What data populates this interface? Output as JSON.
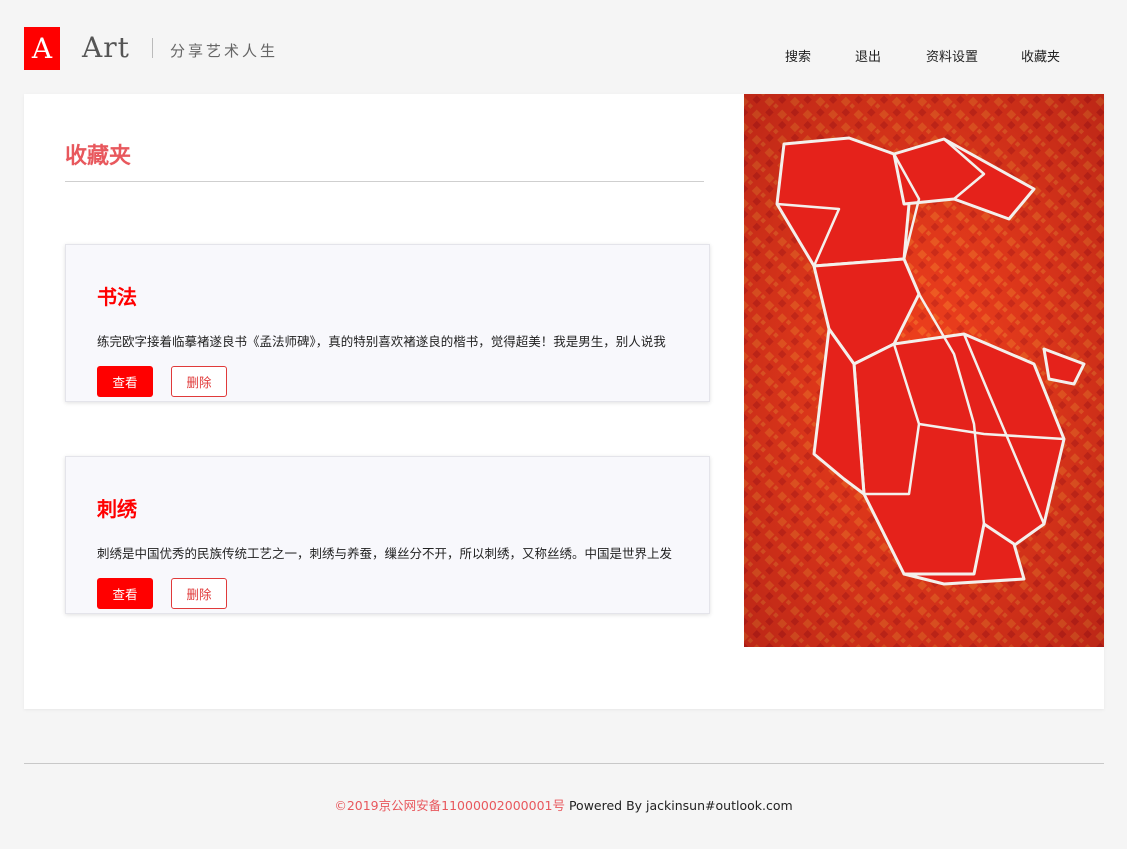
{
  "brand": {
    "logo_letter": "A",
    "name": "Art",
    "slogan": "分享艺术人生",
    "accent_color": "#ff0000"
  },
  "nav": {
    "items": [
      {
        "label": "搜索"
      },
      {
        "label": "退出"
      },
      {
        "label": "资料设置"
      },
      {
        "label": "收藏夹"
      }
    ]
  },
  "main": {
    "section_title": "收藏夹",
    "title_color": "#e8585d",
    "cards": [
      {
        "title": "书法",
        "excerpt": "练完欧字接着临摹褚遂良书《孟法师碑》，真的特别喜欢褚遂良的楷书，觉得超美！我是男生，别人说我",
        "view_label": "查看",
        "delete_label": "删除"
      },
      {
        "title": "刺绣",
        "excerpt": "刺绣是中国优秀的民族传统工艺之一，刺绣与养蚕，缫丝分不开，所以刺绣，又称丝绣。中国是世界上发",
        "view_label": "查看",
        "delete_label": "删除"
      }
    ],
    "artwork": {
      "icon": "origami-rabbit-painting",
      "colors": [
        "#e8261c",
        "#c4141a",
        "#f0622a",
        "#f5f5f5"
      ]
    }
  },
  "footer": {
    "icp": "©2019京公网安备11000002000001号",
    "powered": "Powered By jackinsun#outlook.com"
  }
}
